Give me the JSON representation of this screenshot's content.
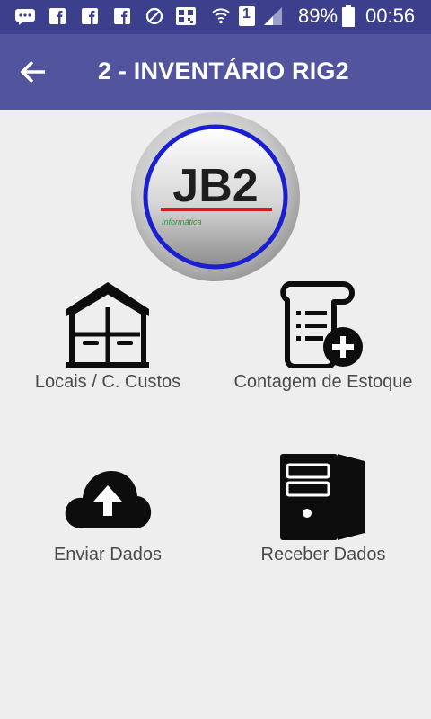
{
  "status_bar": {
    "battery": "89%",
    "time": "00:56",
    "sim": "1",
    "icons": [
      "message-icon",
      "facebook-icon",
      "facebook-icon",
      "facebook-icon",
      "do-not-disturb-icon",
      "qr-code-icon",
      "wifi-icon",
      "sim-icon",
      "signal-icon",
      "battery-icon"
    ]
  },
  "header": {
    "title": "2 - INVENTÁRIO RIG2",
    "back_icon": "arrow-back-icon"
  },
  "logo": {
    "text": "JB2",
    "subtext": "Informática"
  },
  "menu": {
    "items": [
      {
        "label": "Locais / C. Custos",
        "icon": "warehouse-icon"
      },
      {
        "label": "Contagem de Estoque",
        "icon": "stock-count-icon"
      },
      {
        "label": "Enviar Dados",
        "icon": "cloud-upload-icon"
      },
      {
        "label": "Receber Dados",
        "icon": "computer-tower-icon"
      }
    ]
  },
  "colors": {
    "status_bar": "#3b3f8c",
    "app_bar": "#52549e",
    "background": "#eeeeee",
    "label": "#4a4a4a"
  }
}
